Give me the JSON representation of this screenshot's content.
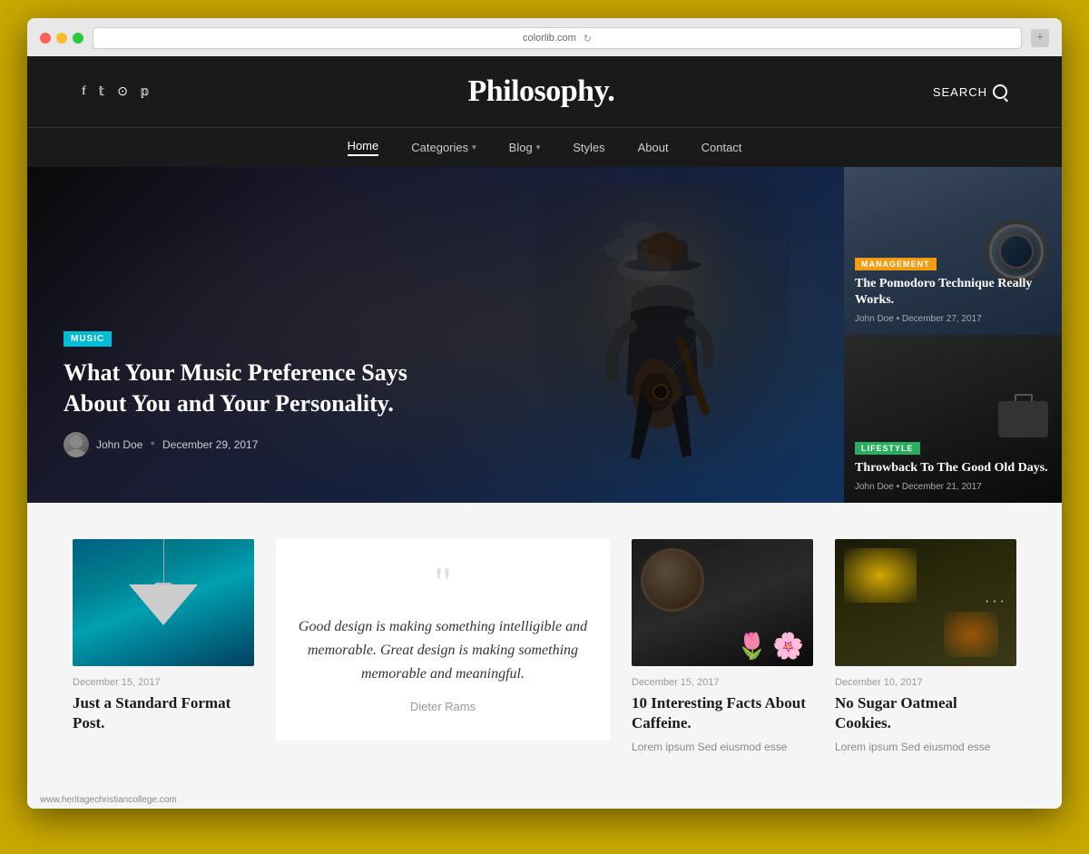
{
  "browser": {
    "url": "colorlib.com",
    "new_tab_label": "+"
  },
  "site": {
    "title": "Philosophy.",
    "search_label": "SEARCH"
  },
  "social": {
    "icons": [
      "f",
      "t",
      "◉",
      "p"
    ]
  },
  "nav": {
    "items": [
      {
        "label": "Home",
        "active": true,
        "has_dropdown": false
      },
      {
        "label": "Categories",
        "active": false,
        "has_dropdown": true
      },
      {
        "label": "Blog",
        "active": false,
        "has_dropdown": true
      },
      {
        "label": "Styles",
        "active": false,
        "has_dropdown": false
      },
      {
        "label": "About",
        "active": false,
        "has_dropdown": false
      },
      {
        "label": "Contact",
        "active": false,
        "has_dropdown": false
      }
    ]
  },
  "hero": {
    "category_badge": "MUSIC",
    "title": "What Your Music Preference Says About You and Your Personality.",
    "author": "John Doe",
    "date": "December 29, 2017"
  },
  "side_cards": [
    {
      "tag": "MANAGEMENT",
      "tag_class": "tag-management",
      "title": "The Pomodoro Technique Really Works.",
      "author": "John Doe",
      "date": "December 27, 2017"
    },
    {
      "tag": "LIFESTYLE",
      "tag_class": "tag-lifestyle",
      "title": "Throwback To The Good Old Days.",
      "author": "John Doe",
      "date": "December 21, 2017"
    }
  ],
  "posts": [
    {
      "type": "image",
      "image_type": "lamp",
      "date": "December 15, 2017",
      "title": "Just a Standard Format Post.",
      "excerpt": ""
    },
    {
      "type": "quote",
      "quote_text": "Good design is making something intelligible and memorable. Great design is making something memorable and meaningful.",
      "quote_author": "Dieter Rams"
    },
    {
      "type": "image",
      "image_type": "coffee",
      "date": "December 15, 2017",
      "title": "10 Interesting Facts About Caffeine.",
      "excerpt": "Lorem ipsum Sed eiusmod esse"
    },
    {
      "type": "image",
      "image_type": "colorful",
      "date": "December 10, 2017",
      "title": "No Sugar Oatmeal Cookies.",
      "excerpt": "Lorem ipsum Sed eiusmod esse"
    }
  ],
  "footer": {
    "url": "www.heritagechristiancollege.com"
  }
}
